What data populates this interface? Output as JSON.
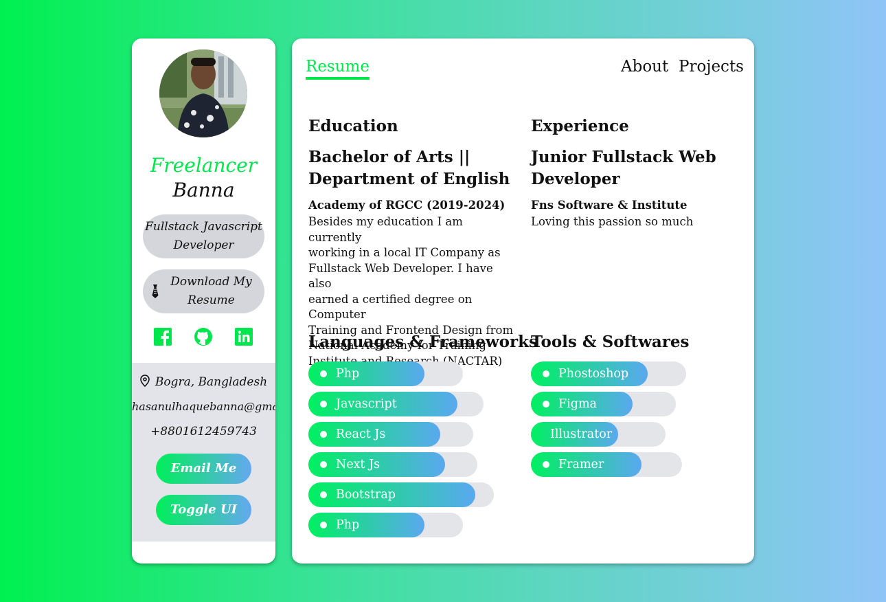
{
  "sidebar": {
    "title_line1": "Freelancer",
    "title_line2": "Banna",
    "role": "Fullstack Javascript Developer",
    "download_label": "Download My Resume",
    "socials": [
      "facebook-icon",
      "github-icon",
      "linkedin-icon"
    ],
    "location": "Bogra, Bangladesh",
    "email": "hasanulhaquebanna@gmail.com",
    "phone": "+8801612459743",
    "email_button": "Email Me",
    "toggle_button": "Toggle UI"
  },
  "nav": {
    "active": "Resume",
    "about": "About",
    "projects": "Projects"
  },
  "education": {
    "heading": "Education",
    "degree_line1": "Bachelor of Arts ||",
    "degree_line2": "Department of English",
    "institution": "Academy of RGCC (2019-2024)",
    "description": [
      "Besides my education I am currently",
      "working in a local IT Company as",
      "Fullstack Web Developer. I have also",
      "earned a certified degree on Computer",
      "Training and Frontend Design from",
      "National Academy for Training",
      "Institute and Research (NACTAR)"
    ]
  },
  "experience": {
    "heading": "Experience",
    "title_line1": "Junior Fullstack Web",
    "title_line2": "Developer",
    "company": "Fns Software & Institute",
    "description": "Loving this passion so much"
  },
  "languages": {
    "heading": "Languages & Frameworks",
    "items": [
      {
        "label": "Php",
        "level": 0.75
      },
      {
        "label": "Javascript",
        "level": 0.85
      },
      {
        "label": "React Js",
        "level": 0.8
      },
      {
        "label": "Next Js",
        "level": 0.81
      },
      {
        "label": "Bootstrap",
        "level": 0.9
      },
      {
        "label": "Php",
        "level": 0.75
      }
    ]
  },
  "tools": {
    "heading": "Tools & Softwares",
    "items": [
      {
        "label": "Phostoshop",
        "level": 0.75,
        "dot": true
      },
      {
        "label": "Figma",
        "level": 0.7,
        "dot": true
      },
      {
        "label": "Illustrator",
        "level": 0.65,
        "dot": false
      },
      {
        "label": "Framer",
        "level": 0.73,
        "dot": true
      }
    ]
  },
  "colors": {
    "accent": "#00e64d",
    "gradient_end": "#5aa8ef",
    "pill_bg": "#d5d6db"
  }
}
